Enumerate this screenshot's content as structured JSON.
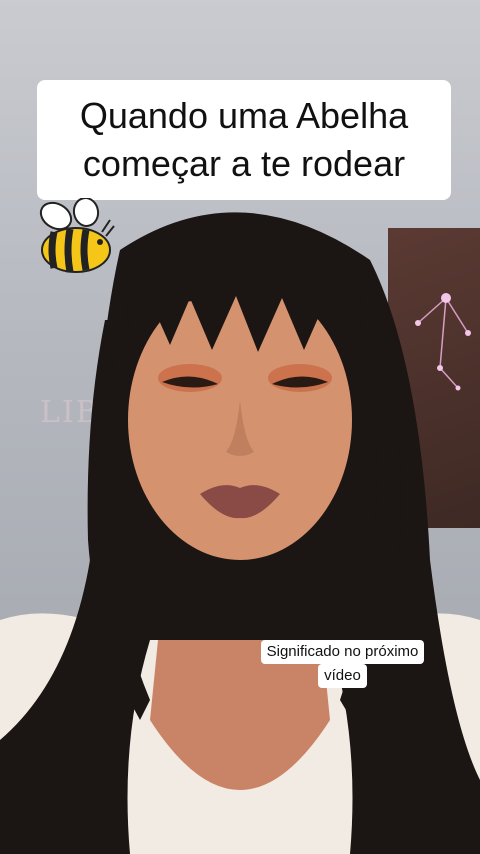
{
  "caption": {
    "line1": "Quando uma Abelha",
    "line2": "começar a te rodear"
  },
  "subtitle": {
    "line1": "Significado no próximo",
    "line2": "vídeo"
  },
  "sticker": {
    "icon": "bee-icon"
  },
  "background_poster": {
    "text": "LIB"
  },
  "colors": {
    "wall": "#b9bcc3",
    "hair": "#1a1412",
    "skin": "#d08d6e",
    "poster": "#4a302a",
    "caption_bg": "#ffffff",
    "bee_yellow": "#f5c518"
  }
}
